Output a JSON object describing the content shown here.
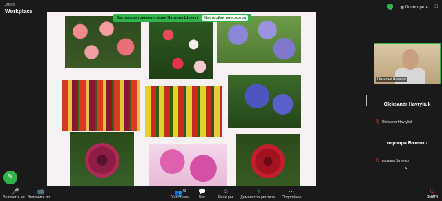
{
  "app": {
    "logo_small": "zoom",
    "logo_big": "Workplace"
  },
  "topbar": {
    "view_label": "Посмотреть",
    "icons": [
      "shield-icon",
      "grid-icon",
      "fullscreen-icon"
    ]
  },
  "banner": {
    "text": "Вы просматриваете экран  Наталья Шевчук",
    "options": "Настройки просмотра"
  },
  "participants": [
    {
      "name": "Наталья Шевчук",
      "type": "video"
    },
    {
      "name": "Oleksandr Havryliuk",
      "type": "name",
      "label": "Oleksandr Havryliuk"
    },
    {
      "name": "варвара Батенко",
      "type": "name",
      "label": "варвара Батенко"
    }
  ],
  "toolbar": {
    "mic_label": "Включить зв...",
    "video_label": "Включить по...",
    "participants_label": "Участники",
    "participants_count": "43",
    "chat_label": "Чат",
    "reactions_label": "Реакции",
    "share_label": "Демонстрация экра...",
    "more_label": "Подробнее",
    "leave_label": "Выйти"
  },
  "colors": {
    "accent": "#2fb34a",
    "danger": "#e03c3c",
    "bg": "#1a1a1a"
  }
}
